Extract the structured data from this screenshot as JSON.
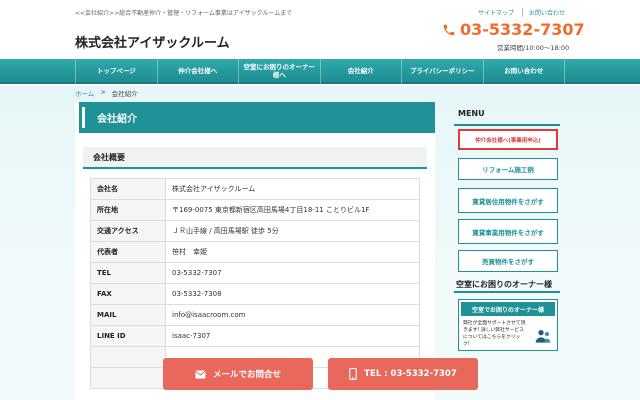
{
  "header": {
    "tagline": "<<会社紹介>>総合不動産仲介・管理・リフォーム事業はアイザックルームまで",
    "top_links": [
      "サイトマップ",
      "お問い合わせ"
    ],
    "logo": "株式会社アイザックルーム",
    "phone": "03-5332-7307",
    "hours": "営業時間/10:00～18:00"
  },
  "nav": {
    "items": [
      "トップページ",
      "仲介会社様へ",
      "空室にお困りのオーナー様へ",
      "会社紹介",
      "プライバシーポリシー",
      "お問い合わせ"
    ]
  },
  "breadcrumb": {
    "home": "ホーム",
    "sep": ">",
    "current": "会社紹介"
  },
  "main": {
    "page_title": "会社紹介",
    "section_title": "会社概要",
    "rows": [
      {
        "label": "会社名",
        "value": "株式会社アイザックルーム"
      },
      {
        "label": "所在地",
        "value": "〒169-0075 東京都新宿区高田馬場4丁目18-11 ことりビル1F"
      },
      {
        "label": "交通アクセス",
        "value": "ＪＲ山手線 / 高田馬場駅 徒歩 5分"
      },
      {
        "label": "代表者",
        "value": "笹村　幸姫"
      },
      {
        "label": "TEL",
        "value": "03-5332-7307"
      },
      {
        "label": "FAX",
        "value": "03-5332-7308"
      },
      {
        "label": "MAIL",
        "value": "info@isaacroom.com"
      },
      {
        "label": "LINE ID",
        "value": "isaac-7307"
      }
    ]
  },
  "sidebar": {
    "menu_title": "MENU",
    "buttons": [
      "仲介会社様へ(事業用申込)",
      "リフォーム施工例",
      "賃貸居住用物件をさがす",
      "賃貸事業用物件をさがす",
      "売買物件をさがす"
    ],
    "owner_title": "空室にお困りのオーナー様",
    "owner_card_title": "空室でお困りのオーナー様",
    "owner_card_text": "弊社が全面サポートさせて頂きます! 詳しい弊社サービスについてはこちらをクリック!"
  },
  "cta": {
    "mail": "メールでお問合せ",
    "tel": "TEL : 03-5332-7307"
  },
  "colors": {
    "teal": "#1e9296",
    "orange": "#ef6c2e",
    "cta": "#e8685c",
    "red": "#e23a3a"
  }
}
